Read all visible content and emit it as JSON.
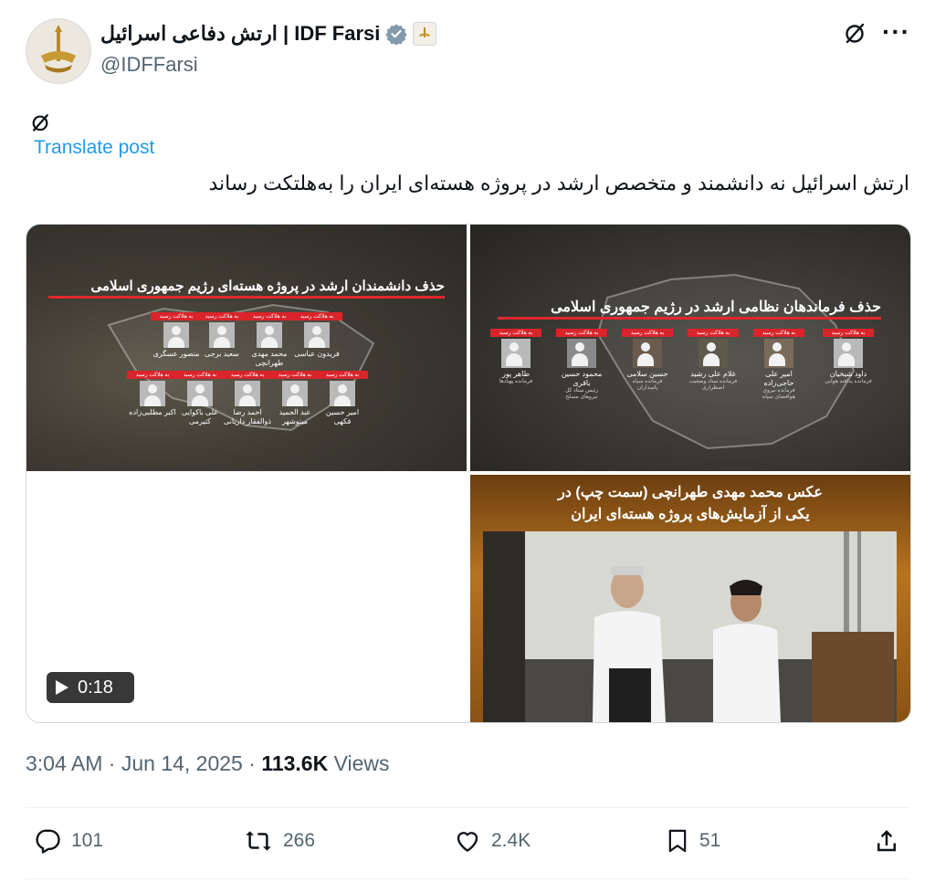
{
  "author": {
    "display_name": "ارتش دفاعی اسرائیل | IDF Farsi",
    "handle": "@IDFFarsi",
    "verified": true
  },
  "post": {
    "translate_label": "Translate post",
    "text": "ارتش اسرائیل نه دانشمند و متخصص ارشد در پروژه هسته‌ای ایران را به‌هلتکت رساند"
  },
  "media": {
    "panel_a": {
      "title": "حذف دانشمندان ارشد در پروژه هسته‌ای رژیم جمهوری اسلامی",
      "tag": "به هلاکت رسید",
      "row1": [
        {
          "name": "منصور عسگری"
        },
        {
          "name": "سعید برجی"
        },
        {
          "name": "محمد مهدی طهرانچی"
        },
        {
          "name": "فریدون عباسی"
        }
      ],
      "row2": [
        {
          "name": "اکبر مطلبی‌زاده"
        },
        {
          "name": "علی باکوایی کتیرمی"
        },
        {
          "name": "احمد رضا ذوالفقار داریانی"
        },
        {
          "name": "عبد الحمید مینوشهر"
        },
        {
          "name": "امیر حسین فکهی"
        }
      ]
    },
    "panel_b": {
      "title": "حذف فرماندهان نظامی ارشد در رژیم جمهوری اسلامی",
      "tag": "به هلاکت رسید",
      "people": [
        {
          "name": "طاهر پور",
          "role": "فرمانده پهپادها"
        },
        {
          "name": "محمود حسین باقری",
          "role": "رئیس ستاد کل نیروهای مسلح"
        },
        {
          "name": "حسین سلامی",
          "role": "فرمانده سپاه پاسداران"
        },
        {
          "name": "غلام علی رشید",
          "role": "فرمانده ستاد وضعیت اضطراری"
        },
        {
          "name": "امیر علی حاجی‌زاده",
          "role": "فرمانده نیروی هوافضای سپاه"
        },
        {
          "name": "داود شیخیان",
          "role": "فرمانده پدافند هوایی"
        }
      ]
    },
    "panel_d": {
      "caption_line1": "عکس محمد مهدی طهرانچی (سمت چپ) در",
      "caption_line2": "یکی از آزمایش‌های پروژه هسته‌ای ایران"
    },
    "video_duration": "0:18"
  },
  "meta": {
    "time": "3:04 AM",
    "date": "Jun 14, 2025",
    "views_count": "113.6K",
    "views_label": "Views"
  },
  "actions": {
    "replies": "101",
    "reposts": "266",
    "likes": "2.4K",
    "bookmarks": "51"
  },
  "icons": [
    "verified-badge-icon",
    "affiliate-badge-icon",
    "more-icon",
    "grok-icon",
    "play-icon",
    "reply-icon",
    "repost-icon",
    "like-icon",
    "bookmark-icon",
    "share-icon"
  ],
  "colors": {
    "link": "#1d9bf0",
    "secondary": "#536471",
    "verified": "#829aab",
    "alert_red": "#d9242b"
  }
}
